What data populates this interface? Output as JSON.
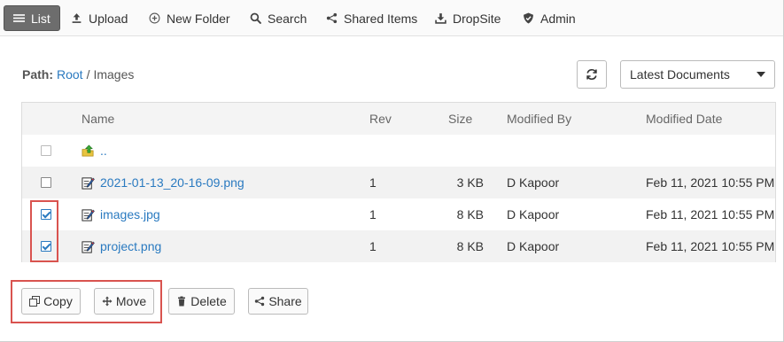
{
  "toolbar": {
    "items": [
      {
        "label": "List",
        "icon": "list-icon"
      },
      {
        "label": "Upload",
        "icon": "upload-icon"
      },
      {
        "label": "New Folder",
        "icon": "new-folder-icon"
      },
      {
        "label": "Search",
        "icon": "search-icon"
      },
      {
        "label": "Shared Items",
        "icon": "share-icon"
      },
      {
        "label": "DropSite",
        "icon": "dropsite-icon"
      },
      {
        "label": "Admin",
        "icon": "shield-icon"
      }
    ]
  },
  "path": {
    "label": "Path:",
    "root": "Root",
    "separator": "/",
    "current": "Images"
  },
  "view_select": {
    "value": "Latest Documents"
  },
  "table": {
    "headers": {
      "name": "Name",
      "rev": "Rev",
      "size": "Size",
      "modified_by": "Modified By",
      "modified_date": "Modified Date"
    },
    "parent": "..",
    "rows": [
      {
        "name": "2021-01-13_20-16-09.png",
        "rev": "1",
        "size": "3 KB",
        "modified_by": "D Kapoor",
        "modified_date": "Feb 11, 2021 10:55 PM",
        "checked": false
      },
      {
        "name": "images.jpg",
        "rev": "1",
        "size": "8 KB",
        "modified_by": "D Kapoor",
        "modified_date": "Feb 11, 2021 10:55 PM",
        "checked": true
      },
      {
        "name": "project.png",
        "rev": "1",
        "size": "8 KB",
        "modified_by": "D Kapoor",
        "modified_date": "Feb 11, 2021 10:55 PM",
        "checked": true
      }
    ]
  },
  "actions": {
    "copy": "Copy",
    "move": "Move",
    "delete": "Delete",
    "share": "Share"
  },
  "colors": {
    "accent": "#2a7ac0",
    "highlight": "#d9534f"
  }
}
